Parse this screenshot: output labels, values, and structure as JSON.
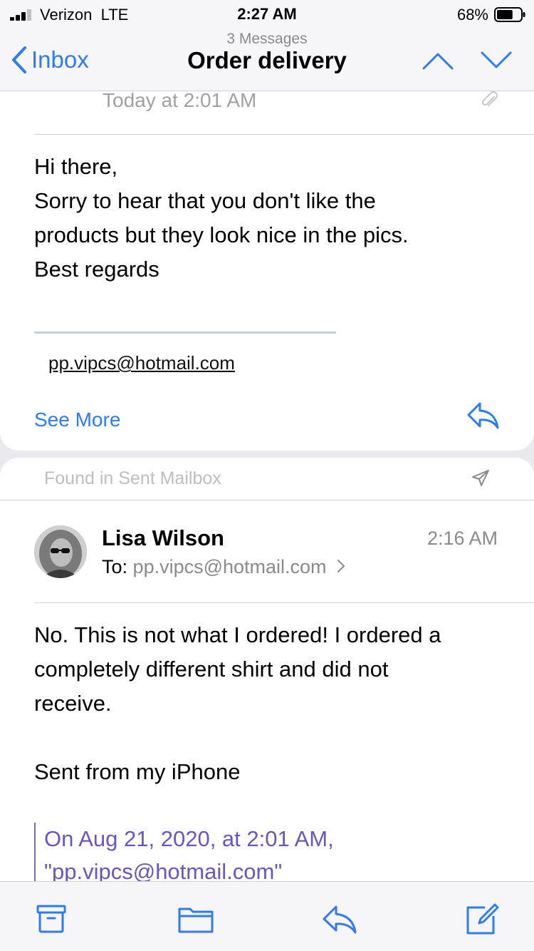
{
  "status_bar": {
    "carrier": "Verizon",
    "network": "LTE",
    "time": "2:27 AM",
    "battery_percent": "68%",
    "battery_level": 0.68
  },
  "nav": {
    "back_label": "Inbox",
    "message_count": "3 Messages",
    "title": "Order delivery"
  },
  "message_1": {
    "date": "Today at 2:01 AM",
    "body": "Hi there,\nSorry to hear that you don't like the\nproducts but they look nice in the pics.\nBest regards",
    "signature_email": "pp.vipcs@hotmail.com",
    "see_more_label": "See More"
  },
  "message_2": {
    "mailbox_label": "Found in Sent Mailbox",
    "sender": "Lisa Wilson",
    "time": "2:16 AM",
    "to_label": "To:",
    "to_address": "pp.vipcs@hotmail.com",
    "body": "No. This is not what I ordered! I ordered a\ncompletely different shirt and did not\nreceive.",
    "signature": "Sent from my iPhone",
    "quote_header": "On Aug 21, 2020, at 2:01 AM,\n\"pp.vipcs@hotmail.com\""
  },
  "colors": {
    "accent": "#2d7cf6",
    "quote": "#6b55c0",
    "secondary_text": "#8a8a8e"
  },
  "icons": {
    "back": "chevron-left-icon",
    "prev": "chevron-up-icon",
    "next": "chevron-down-icon",
    "attachment": "paperclip-icon",
    "reply": "reply-icon",
    "sent": "paper-plane-icon",
    "archive": "archive-icon",
    "folder": "folder-icon",
    "compose": "compose-icon"
  }
}
